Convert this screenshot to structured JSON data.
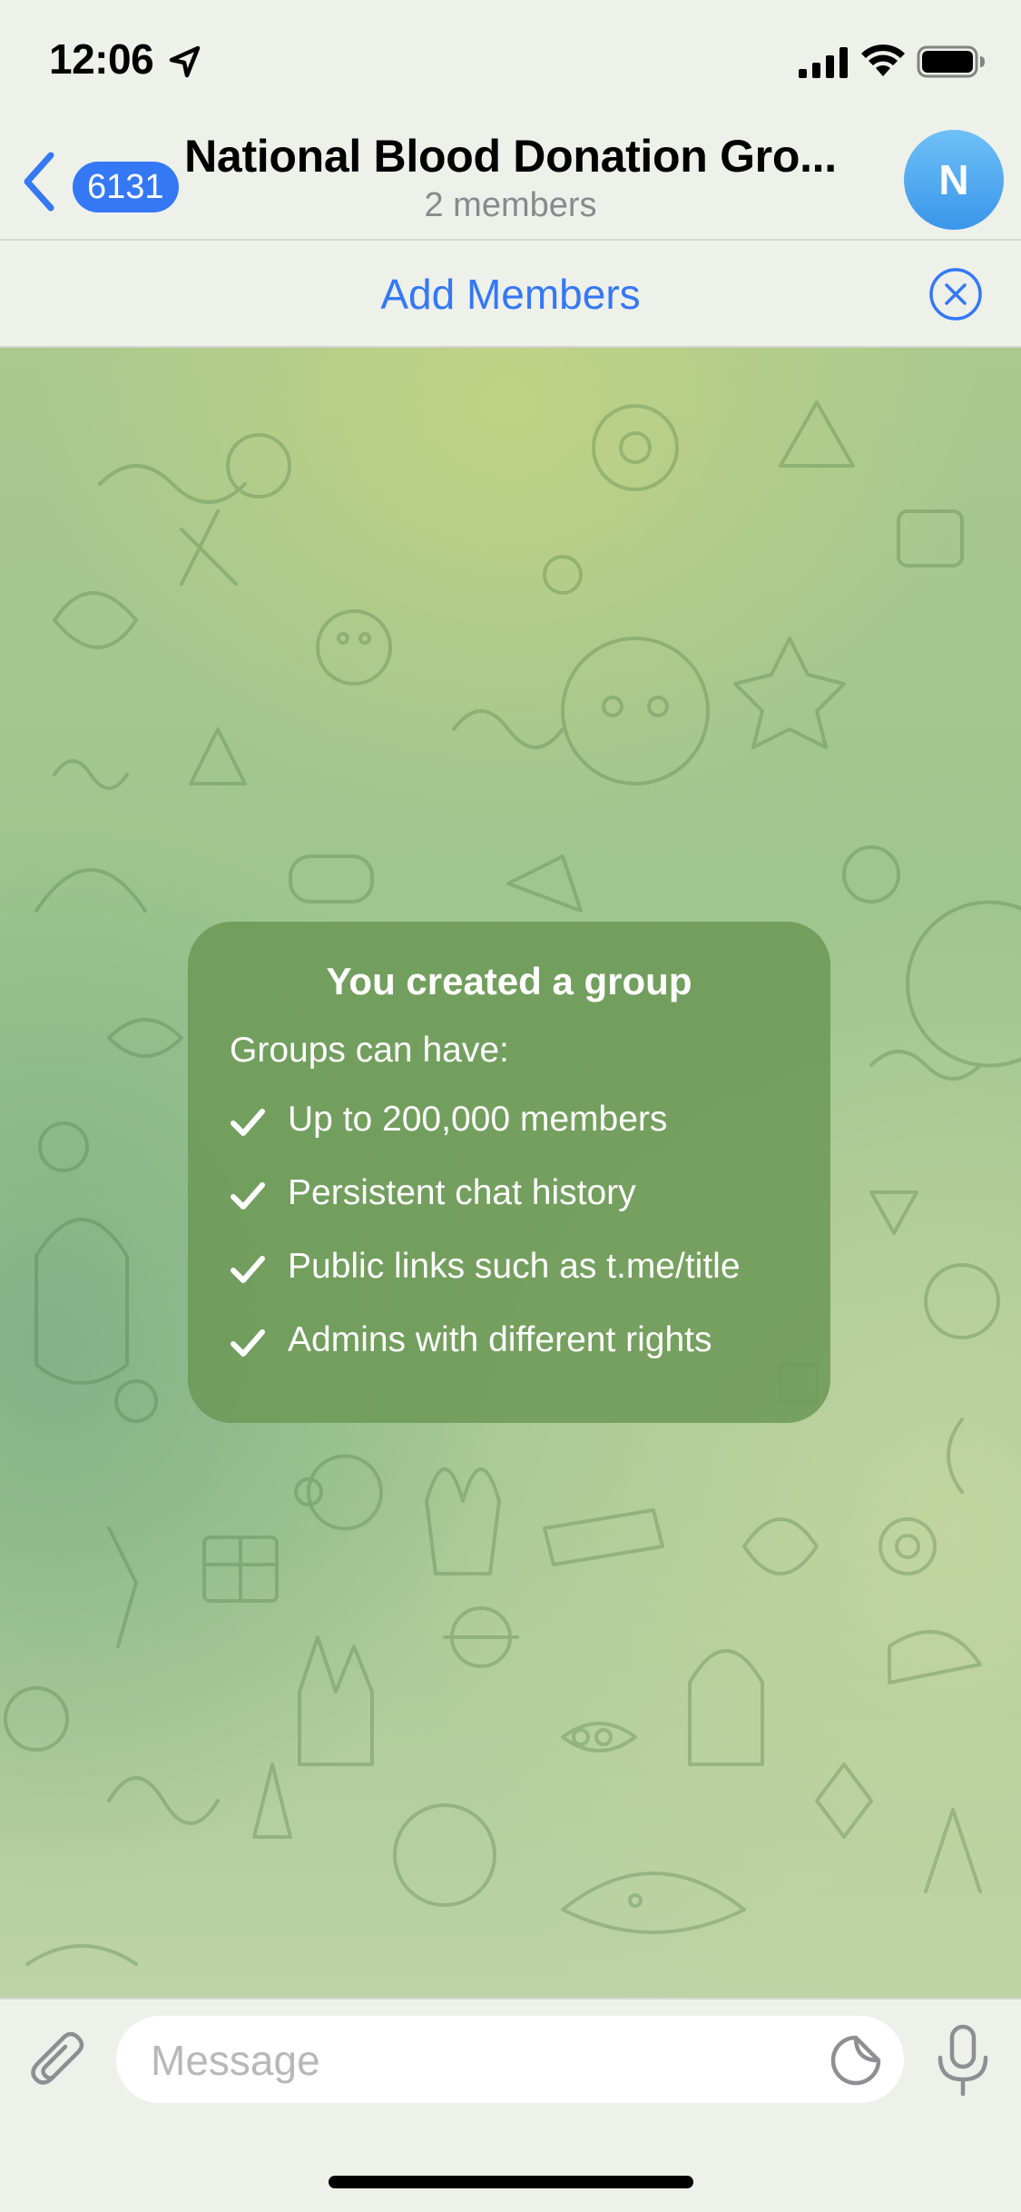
{
  "status_bar": {
    "time": "12:06",
    "icons": [
      "location-arrow-icon",
      "cellular-signal-icon",
      "wifi-icon",
      "battery-icon"
    ]
  },
  "header": {
    "back_badge_count": "6131",
    "title": "National Blood Donation Gro...",
    "subtitle": "2 members",
    "avatar_initial": "N"
  },
  "banner": {
    "add_members_label": "Add Members"
  },
  "service_message": {
    "title": "You created a group",
    "intro": "Groups can have:",
    "features": [
      "Up to 200,000 members",
      "Persistent chat history",
      "Public links such as t.me/title",
      "Admins with different rights"
    ]
  },
  "input": {
    "placeholder": "Message",
    "value": ""
  },
  "colors": {
    "accent": "#3478f6",
    "avatar_gradient_top": "#6fc0f7",
    "avatar_gradient_bottom": "#3a96ea",
    "bubble": "#6c9856",
    "bar_background": "#eef0ea"
  }
}
